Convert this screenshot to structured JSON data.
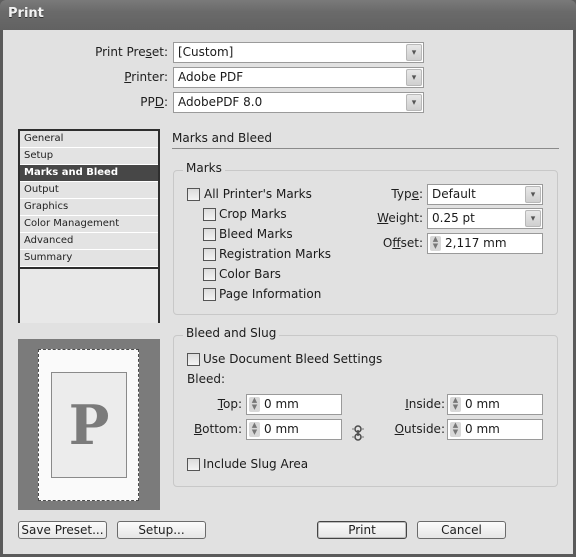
{
  "window": {
    "title": "Print"
  },
  "header": {
    "print_preset": {
      "label": "Print Preset:",
      "mnemonic_prefix": "Print Pre",
      "mnemonic": "s",
      "mnemonic_suffix": "et:",
      "value": "[Custom]"
    },
    "printer": {
      "mnemonic": "P",
      "mnemonic_suffix": "rinter:",
      "value": "Adobe PDF"
    },
    "ppd": {
      "mnemonic_prefix": "PP",
      "mnemonic": "D",
      "mnemonic_suffix": ":",
      "value": "AdobePDF 8.0"
    }
  },
  "sidebar": {
    "items": [
      {
        "label": "General",
        "selected": false
      },
      {
        "label": "Setup",
        "selected": false
      },
      {
        "label": "Marks and Bleed",
        "selected": true
      },
      {
        "label": "Output",
        "selected": false
      },
      {
        "label": "Graphics",
        "selected": false
      },
      {
        "label": "Color Management",
        "selected": false
      },
      {
        "label": "Advanced",
        "selected": false
      },
      {
        "label": "Summary",
        "selected": false
      }
    ]
  },
  "preview": {
    "letter": "P"
  },
  "main": {
    "section_title": "Marks and Bleed",
    "marks": {
      "group_title": "Marks",
      "all_printers_marks": {
        "label": "All Printer's Marks",
        "checked": false
      },
      "crop_marks": {
        "label": "Crop Marks",
        "checked": false
      },
      "bleed_marks": {
        "label": "Bleed Marks",
        "checked": false
      },
      "registration_marks": {
        "label": "Registration Marks",
        "checked": false
      },
      "color_bars": {
        "label": "Color Bars",
        "checked": false
      },
      "page_information": {
        "label": "Page Information",
        "checked": false
      },
      "type": {
        "prefix": "Typ",
        "mnemonic": "e",
        "suffix": ":",
        "value": "Default"
      },
      "weight": {
        "mnemonic": "W",
        "suffix": "eight:",
        "value": "0.25 pt"
      },
      "offset": {
        "prefix": "O",
        "mnemonic": "f",
        "suffix": "fset:",
        "value": "2,117 mm"
      }
    },
    "bleed_slug": {
      "group_title": "Bleed and Slug",
      "use_document_bleed": {
        "label": "Use Document Bleed Settings",
        "checked": false
      },
      "bleed_label": "Bleed:",
      "top": {
        "mnemonic": "T",
        "suffix": "op:",
        "value": "0 mm"
      },
      "bottom": {
        "mnemonic": "B",
        "suffix": "ottom:",
        "value": "0 mm"
      },
      "inside": {
        "mnemonic": "I",
        "suffix": "nside:",
        "value": "0 mm"
      },
      "outside": {
        "mnemonic": "O",
        "suffix": "utside:",
        "value": "0 mm"
      },
      "include_slug": {
        "label": "Include Slug Area",
        "checked": false
      }
    }
  },
  "footer": {
    "save_preset": "Save Preset...",
    "setup": "Setup...",
    "print": "Print",
    "cancel": "Cancel"
  },
  "icons": {
    "dropdown": "▾",
    "spin_up": "▲",
    "spin_down": "▼"
  }
}
